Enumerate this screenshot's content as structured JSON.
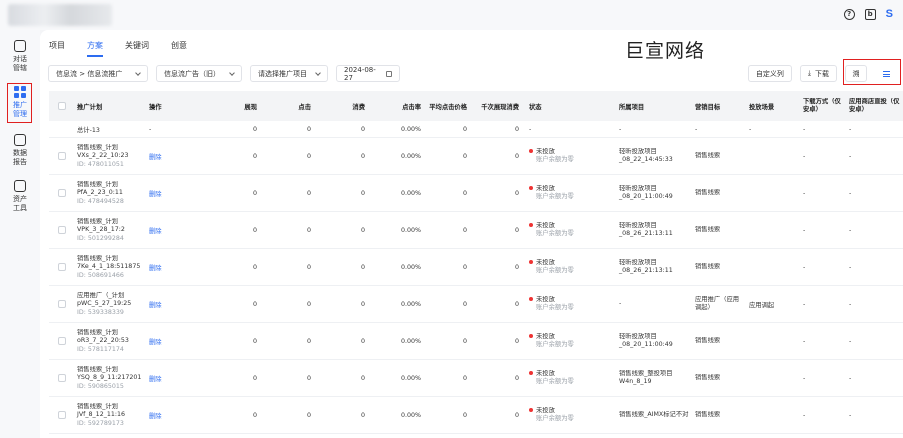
{
  "header": {
    "user_initial": "S",
    "help_icon": "?",
    "share_icon": "b"
  },
  "sidebar": {
    "items": [
      {
        "label": "对话\n管辖",
        "icon": "chat-icon"
      },
      {
        "label": "推广\n管理",
        "icon": "grid-icon",
        "active": true
      },
      {
        "label": "数据\n报告",
        "icon": "report-icon"
      },
      {
        "label": "资产\n工具",
        "icon": "asset-icon"
      }
    ]
  },
  "tabs": [
    "项目",
    "方案",
    "关键词",
    "创意"
  ],
  "active_tab": "方案",
  "watermark": "巨宣网络",
  "filters": {
    "channel": "信息流 > 信息流推广",
    "ad_type": "信息流广告（旧）",
    "project": "请选择推广项目",
    "date": "2024-08-27"
  },
  "toolbar": {
    "custom_cols": "自定义列",
    "download": "下载",
    "icon_btn1": "溯",
    "icon_btn2": "≡"
  },
  "columns": [
    "推广计划",
    "操作",
    "展现",
    "点击",
    "消费",
    "点击率",
    "平均点击价格",
    "千次展现消费",
    "状态",
    "所属项目",
    "营销目标",
    "投放场景",
    "下载方式（仅安卓）",
    "应用商店直投（仅安卓）"
  ],
  "total_row": {
    "name": "总计-13",
    "op": "-",
    "exp": "0",
    "clk": "0",
    "cost": "0",
    "ctr": "0.00%",
    "avg": "0",
    "kc": "0",
    "status": "-",
    "proj": "-",
    "goal": "-",
    "scene": "-",
    "dl": "-",
    "appstore": "-"
  },
  "rows": [
    {
      "name": "销售线索_计划VXs_2_22_10:23",
      "id": "ID: 478011051",
      "op": "删除",
      "exp": "0",
      "clk": "0",
      "cost": "0",
      "ctr": "0.00%",
      "avg": "0",
      "kc": "0",
      "status": "未投放",
      "sub": "账户余额为零",
      "proj": "轻昕投放项目_08_22_14:45:33",
      "goal": "销售线索",
      "scene": "",
      "dl": "-",
      "appstore": "-"
    },
    {
      "name": "销售线索_计划PfA_2_23_0:11",
      "id": "ID: 478494528",
      "op": "删除",
      "exp": "0",
      "clk": "0",
      "cost": "0",
      "ctr": "0.00%",
      "avg": "0",
      "kc": "0",
      "status": "未投放",
      "sub": "账户余额为零",
      "proj": "轻昕投放项目_08_20_11:00:49",
      "goal": "销售线索",
      "scene": "",
      "dl": "-",
      "appstore": "-"
    },
    {
      "name": "销售线索_计划VPK_3_28_17:2",
      "id": "ID: 501299284",
      "op": "删除",
      "exp": "0",
      "clk": "0",
      "cost": "0",
      "ctr": "0.00%",
      "avg": "0",
      "kc": "0",
      "status": "未投放",
      "sub": "账户余额为零",
      "proj": "轻昕投放项目_08_26_21:13:11",
      "goal": "销售线索",
      "scene": "",
      "dl": "-",
      "appstore": "-"
    },
    {
      "name": "销售线索_计划7Ke_4_1_18:511875",
      "id": "ID: 508691466",
      "op": "删除",
      "exp": "0",
      "clk": "0",
      "cost": "0",
      "ctr": "0.00%",
      "avg": "0",
      "kc": "0",
      "status": "未投放",
      "sub": "账户余额为零",
      "proj": "轻昕投放项目_08_26_21:13:11",
      "goal": "销售线索",
      "scene": "",
      "dl": "-",
      "appstore": "-"
    },
    {
      "name": "应用推广（_计划pWC_5_27_19:25",
      "id": "ID: 539338339",
      "op": "删除",
      "exp": "0",
      "clk": "0",
      "cost": "0",
      "ctr": "0.00%",
      "avg": "0",
      "kc": "0",
      "status": "未投放",
      "sub": "账户余额为零",
      "proj": "-",
      "goal": "应用推广（应用调起）",
      "scene": "应用调起",
      "dl": "-",
      "appstore": "-"
    },
    {
      "name": "销售线索_计划oR3_7_22_20:53",
      "id": "ID: 578117174",
      "op": "删除",
      "exp": "0",
      "clk": "0",
      "cost": "0",
      "ctr": "0.00%",
      "avg": "0",
      "kc": "0",
      "status": "未投放",
      "sub": "账户余额为零",
      "proj": "轻昕投放项目_08_20_11:00:49",
      "goal": "销售线索",
      "scene": "",
      "dl": "-",
      "appstore": "-"
    },
    {
      "name": "销售线索_计划YSQ_8_9_11:217201",
      "id": "ID: 590865015",
      "op": "删除",
      "exp": "0",
      "clk": "0",
      "cost": "0",
      "ctr": "0.00%",
      "avg": "0",
      "kc": "0",
      "status": "未投放",
      "sub": "账户余额为零",
      "proj": "销售线索_整投项目W4n_8_19",
      "goal": "销售线索",
      "scene": "",
      "dl": "-",
      "appstore": "-"
    },
    {
      "name": "销售线索_计划JVf_8_12_11:16",
      "id": "ID: 592789173",
      "op": "删除",
      "exp": "0",
      "clk": "0",
      "cost": "0",
      "ctr": "0.00%",
      "avg": "0",
      "kc": "0",
      "status": "未投放",
      "sub": "账户余额为零",
      "proj": "销售线索_AIMX标记不对",
      "goal": "销售线索",
      "scene": "",
      "dl": "-",
      "appstore": "-"
    }
  ],
  "colors": {
    "accent": "#2d6cf0",
    "highlight": "#e02020",
    "status_dot": "#ee3333"
  }
}
